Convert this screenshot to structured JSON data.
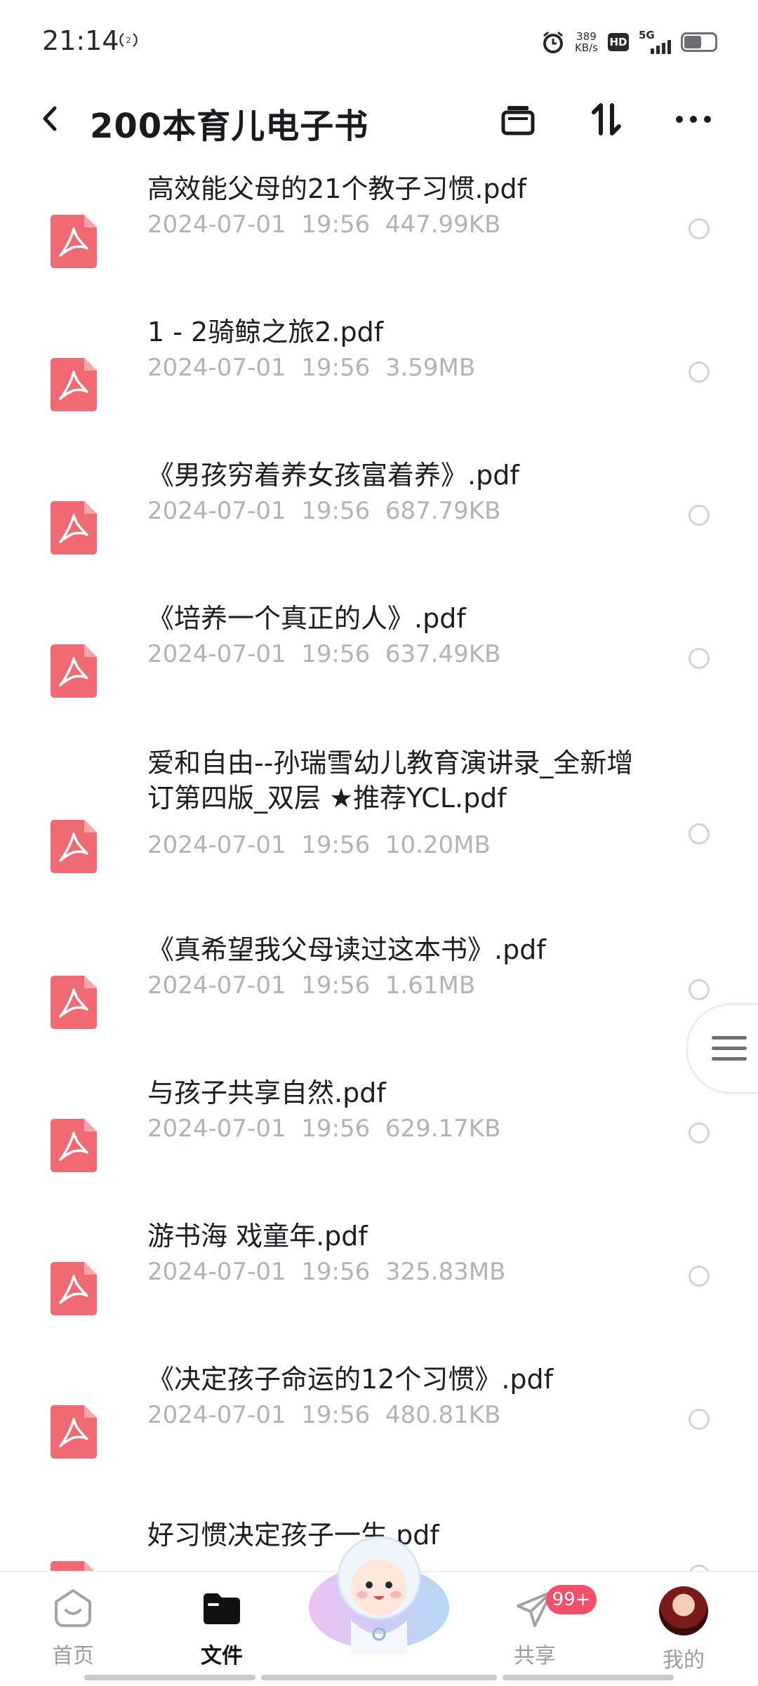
{
  "status_bar": {
    "time": "21:14",
    "net_speed_value": "389",
    "net_speed_unit": "KB/s",
    "hd": "HD",
    "network": "5G",
    "battery_level": 0.55
  },
  "header": {
    "title": "200本育儿电子书"
  },
  "files": [
    {
      "name": "高效能父母的21个教子习惯.pdf",
      "date": "2024-07-01",
      "time": "19:56",
      "size": "447.99KB"
    },
    {
      "name": "1 - 2骑鲸之旅2.pdf",
      "date": "2024-07-01",
      "time": "19:56",
      "size": "3.59MB"
    },
    {
      "name": "《男孩穷着养女孩富着养》.pdf",
      "date": "2024-07-01",
      "time": "19:56",
      "size": "687.79KB"
    },
    {
      "name": "《培养一个真正的人》.pdf",
      "date": "2024-07-01",
      "time": "19:56",
      "size": "637.49KB"
    },
    {
      "name": "爱和自由--孙瑞雪幼儿教育演讲录_全新增订第四版_双层 ★推荐YCL.pdf",
      "date": "2024-07-01",
      "time": "19:56",
      "size": "10.20MB"
    },
    {
      "name": "《真希望我父母读过这本书》.pdf",
      "date": "2024-07-01",
      "time": "19:56",
      "size": "1.61MB"
    },
    {
      "name": "与孩子共享自然.pdf",
      "date": "2024-07-01",
      "time": "19:56",
      "size": "629.17KB"
    },
    {
      "name": "游书海 戏童年.pdf",
      "date": "2024-07-01",
      "time": "19:56",
      "size": "325.83MB"
    },
    {
      "name": "《决定孩子命运的12个习惯》.pdf",
      "date": "2024-07-01",
      "time": "19:56",
      "size": "480.81KB"
    },
    {
      "name": "好习惯决定孩子一生.pdf",
      "date": "",
      "time": "",
      "size": ""
    }
  ],
  "bottom_nav": {
    "home": "首页",
    "files": "文件",
    "share": "共享",
    "share_badge": "99+",
    "mine": "我的"
  },
  "colors": {
    "pdf_icon": "#f06a74",
    "badge": "#f4506a",
    "meta_text": "#b2b2ba"
  }
}
